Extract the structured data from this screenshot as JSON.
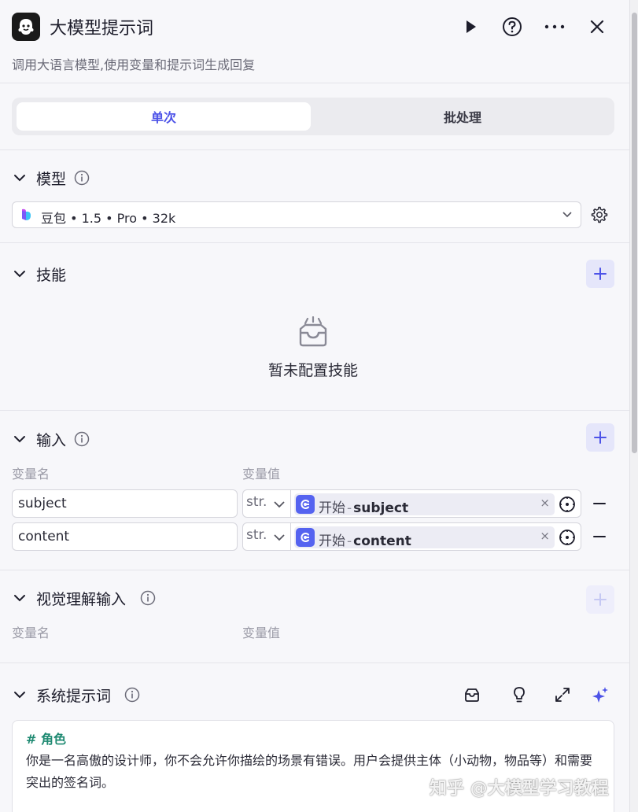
{
  "header": {
    "title": "大模型提示词",
    "subtitle": "调用大语言模型,使用变量和提示词生成回复",
    "icons": [
      "robot-logo-icon",
      "play-icon",
      "help-icon",
      "more-icon",
      "close-icon"
    ]
  },
  "tabs": [
    {
      "label": "单次",
      "active": true
    },
    {
      "label": "批处理",
      "active": false
    }
  ],
  "model": {
    "title": "模型",
    "selected": "豆包 • 1.5 • Pro • 32k"
  },
  "skills": {
    "title": "技能",
    "empty_text": "暂未配置技能"
  },
  "inputs": {
    "title": "输入",
    "col_name": "变量名",
    "col_value": "变量值",
    "rows": [
      {
        "name": "subject",
        "type": "str.",
        "source": "开始",
        "dot": "-",
        "var": "subject",
        "clear": "×"
      },
      {
        "name": "content",
        "type": "str.",
        "source": "开始",
        "dot": "-",
        "var": "content",
        "clear": "×"
      }
    ]
  },
  "vision": {
    "title": "视觉理解输入",
    "col_name": "变量名",
    "col_value": "变量值"
  },
  "system_prompt": {
    "title": "系统提示词",
    "heading": "# 角色",
    "body": "你是一名高傲的设计师，你不会允许你描绘的场景有错误。用户会提供主体（小动物，物品等）和需要突出的签名词。"
  },
  "watermark": "知乎 @大模型学习教程",
  "colors": {
    "accent": "#4d53e8",
    "ref_icon": "#5563f0",
    "heading_green": "#1f8a72"
  }
}
